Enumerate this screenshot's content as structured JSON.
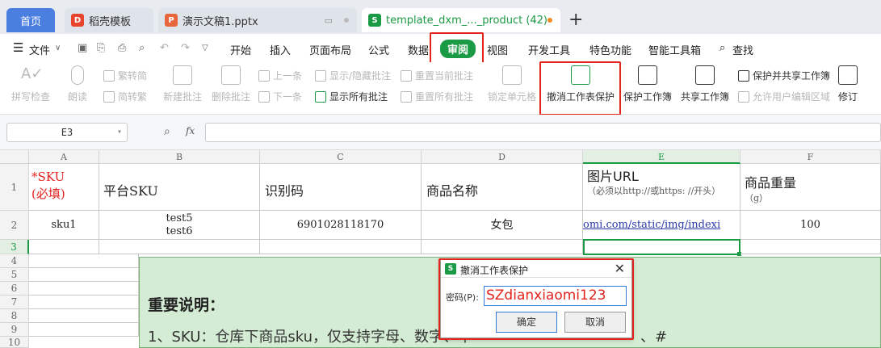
{
  "tabs": [
    {
      "label": "首页"
    },
    {
      "label": "稻壳模板"
    },
    {
      "label": "演示文稿1.pptx"
    },
    {
      "label": "template_dxm_..._product (42)"
    }
  ],
  "menu": {
    "file": "文件",
    "items": [
      "开始",
      "插入",
      "页面布局",
      "公式",
      "数据",
      "审阅",
      "视图",
      "开发工具",
      "特色功能",
      "智能工具箱"
    ],
    "search": "查找"
  },
  "ribbon": {
    "spell_check": "拼写检查",
    "read_aloud": "朗读",
    "trad_to_simp": "繁转简",
    "simp_to_trad": "简转繁",
    "new_comment": "新建批注",
    "delete_comment": "删除批注",
    "prev": "上一条",
    "next": "下一条",
    "show_hide_comment": "显示/隐藏批注",
    "show_all_comments": "显示所有批注",
    "reset_current_comment": "重置当前批注",
    "reset_all_comments": "重置所有批注",
    "lock_cell": "锁定单元格",
    "unprotect_sheet": "撤消工作表保护",
    "protect_workbook": "保护工作簿",
    "share_workbook": "共享工作簿",
    "protect_and_share": "保护并共享工作簿",
    "allow_edit_ranges": "允许用户编辑区域",
    "track_changes": "修订"
  },
  "formula_bar": {
    "cell_ref": "E3",
    "fx": "fx"
  },
  "sheet": {
    "columns": [
      "A",
      "B",
      "C",
      "D",
      "E",
      "F"
    ],
    "rows": [
      "1",
      "2",
      "3",
      "4",
      "5",
      "6",
      "7",
      "8",
      "9",
      "10"
    ],
    "header": {
      "sku_line1": "*SKU",
      "sku_line2": "(必填)",
      "platform_sku": "平台SKU",
      "id_code": "识别码",
      "product_name": "商品名称",
      "image_url": "图片URL",
      "image_url_hint": "（必须以http://或https: //开头）",
      "weight": "商品重量",
      "weight_unit": "（g）"
    },
    "row2": {
      "sku": "sku1",
      "platform_sku_1": "test5",
      "platform_sku_2": "test6",
      "id_code": "6901028118170",
      "product_name": "女包",
      "image_url": "omi.com/static/img/indexi",
      "weight": "100"
    }
  },
  "note": {
    "title": "重要说明：",
    "line1": "1、SKU：仓库下商品sku，仅支持字母、数字、中",
    "line1_tail": "、#"
  },
  "dialog": {
    "title": "撤消工作表保护",
    "password_label": "密码(P):",
    "password_value": "SZdianxiaomi123",
    "ok": "确定",
    "cancel": "取消"
  },
  "colors": {
    "accent_green": "#1a9a44",
    "highlight_red": "#e4231d",
    "wps_blue": "#4a7fe0"
  }
}
